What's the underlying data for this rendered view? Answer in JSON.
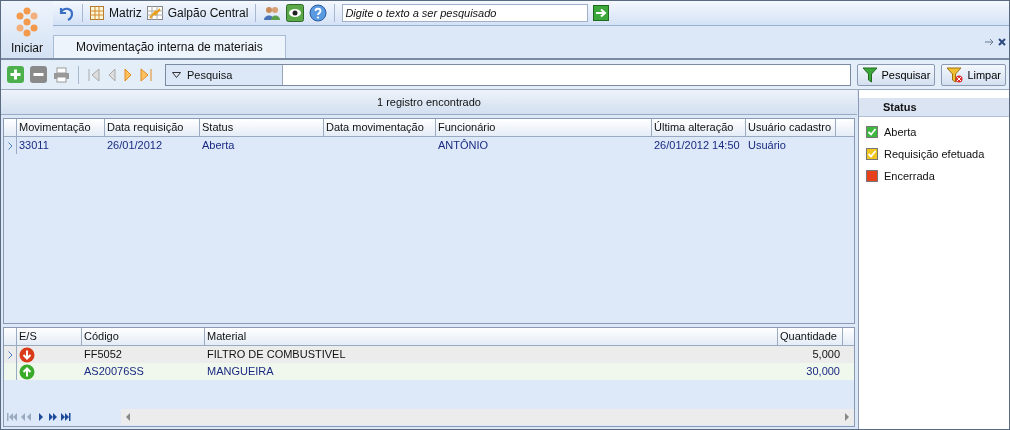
{
  "toolbar": {
    "start_label": "Iniciar",
    "company": "Matriz",
    "branch": "Galpão Central",
    "search": {
      "placeholder": "Digite o texto a ser pesquisado"
    }
  },
  "tabs": [
    {
      "label": "Movimentação interna de materiais",
      "selected": true
    }
  ],
  "record_toolbar": {
    "filter_label": "Pesquisa",
    "search_button": "Pesquisar",
    "clear_button": "Limpar"
  },
  "grid": {
    "summary": "1 registro encontrado",
    "columns": [
      "Movimentação",
      "Data requisição",
      "Status",
      "Data movimentação",
      "Funcionário",
      "Última alteração",
      "Usuário cadastro"
    ],
    "rows": [
      {
        "selected": true,
        "cells": [
          "33011",
          "26/01/2012",
          "Aberta",
          "",
          "ANTÔNIO",
          "26/01/2012 14:50",
          "Usuário"
        ]
      }
    ]
  },
  "detail": {
    "columns": [
      "E/S",
      "Código",
      "Material",
      "Quantidade"
    ],
    "rows": [
      {
        "selected": true,
        "kind": "out",
        "code": "FF5052",
        "material": "FILTRO DE COMBUSTIVEL",
        "quantity": "5,000"
      },
      {
        "selected": false,
        "kind": "in",
        "code": "AS20076SS",
        "material": "MANGUEIRA",
        "quantity": "30,000"
      }
    ]
  },
  "legend": {
    "title": "Status",
    "items": [
      {
        "label": "Aberta",
        "color": "#3cb83c",
        "checked": true
      },
      {
        "label": "Requisição efetuada",
        "color": "#f2c51c",
        "checked": true
      },
      {
        "label": "Encerrada",
        "color": "#e8401c",
        "checked": false
      }
    ]
  }
}
